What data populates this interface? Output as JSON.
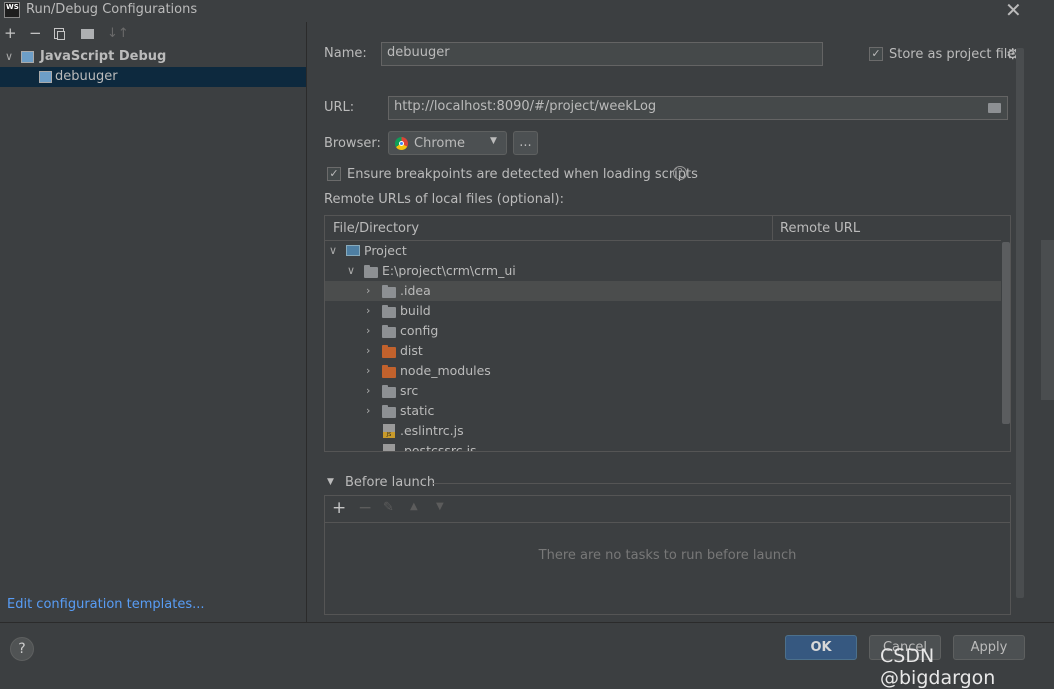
{
  "window": {
    "app_logo": "WS",
    "title": "Run/Debug Configurations"
  },
  "left": {
    "config_type": "JavaScript Debug",
    "config_item": "debuuger",
    "edit_templates_link": "Edit configuration templates..."
  },
  "form": {
    "name_label": "Name:",
    "name_value": "debuuger",
    "store_label": "Store as project file",
    "url_label": "URL:",
    "url_value": "http://localhost:8090/#/project/weekLog",
    "browser_label": "Browser:",
    "browser_value": "Chrome",
    "browser_more": "...",
    "ensure_label": "Ensure breakpoints are detected when loading scripts",
    "remote_label": "Remote URLs of local files (optional):"
  },
  "table": {
    "col_file": "File/Directory",
    "col_remote": "Remote URL",
    "rows": [
      {
        "name": "Project"
      },
      {
        "name": "E:\\project\\crm\\crm_ui"
      },
      {
        "name": ".idea"
      },
      {
        "name": "build"
      },
      {
        "name": "config"
      },
      {
        "name": "dist"
      },
      {
        "name": "node_modules"
      },
      {
        "name": "src"
      },
      {
        "name": "static"
      },
      {
        "name": ".eslintrc.js"
      },
      {
        "name": ".postcssrc.js"
      }
    ]
  },
  "before_launch": {
    "title": "Before launch",
    "empty_text": "There are no tasks to run before launch"
  },
  "buttons": {
    "help": "?",
    "ok": "OK",
    "cancel": "Cancel",
    "apply": "Apply"
  },
  "watermark": "CSDN @bigdargon",
  "colors": {
    "accent": "#365880",
    "link": "#589df6",
    "selection": "#0d293e",
    "folder_gray": "#8d9093",
    "folder_excluded": "#c2622d"
  }
}
